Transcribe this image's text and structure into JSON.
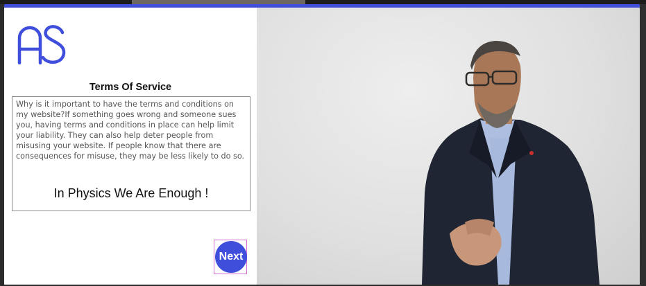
{
  "brand": {
    "logo_text": "AS",
    "accent_color": "#3f4fdc"
  },
  "terms": {
    "title": "Terms Of Service",
    "body": "Why is it important to have the terms and conditions on my website?If something goes wrong and someone sues you, having terms and conditions in place can help limit your liability. They can also help deter people from misusing your website. If people know that there are consequences for misuse, they may be less likely to do so.",
    "tagline": "In Physics We Are Enough !"
  },
  "actions": {
    "next_label": "Next"
  },
  "media": {
    "subject": "presenter-photo"
  }
}
